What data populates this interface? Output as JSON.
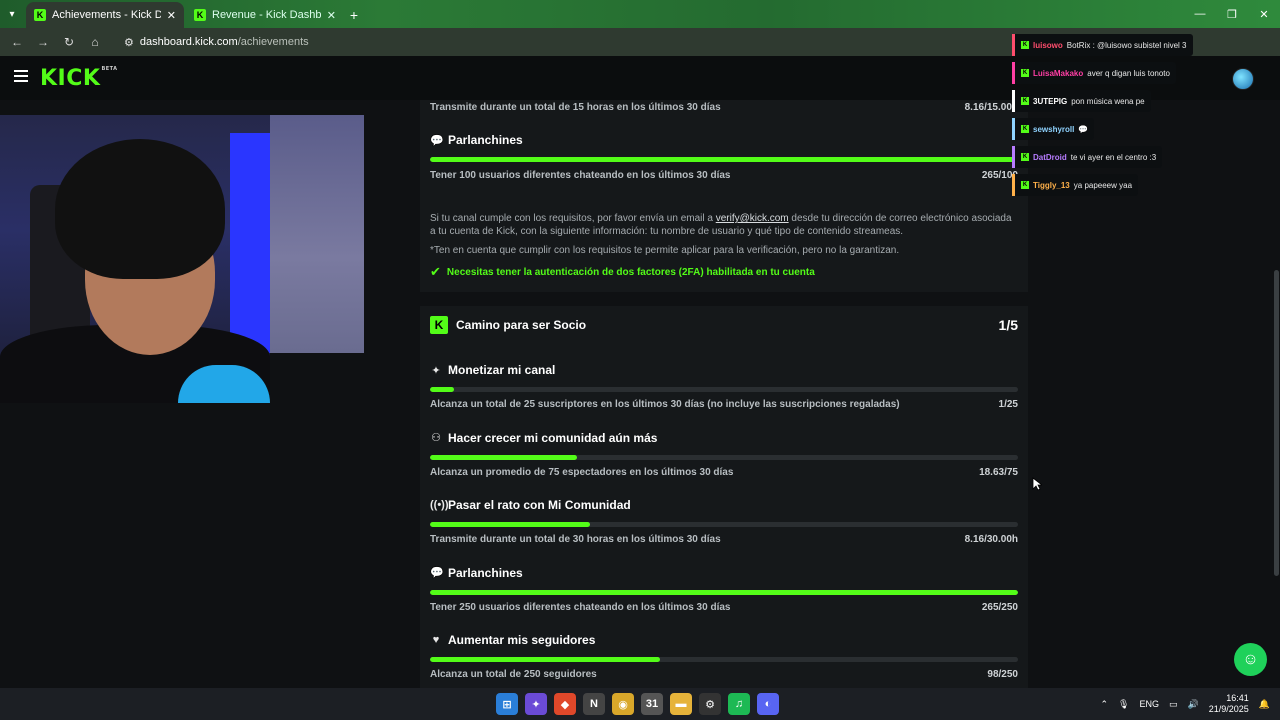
{
  "browser": {
    "tabs": [
      {
        "title": "Achievements - Kick Dashboard",
        "active": true
      },
      {
        "title": "Revenue - Kick Dashboard",
        "active": false
      }
    ],
    "url_host": "dashboard.kick.com",
    "url_path": "/achievements"
  },
  "header": {
    "logo": "KICK",
    "logo_badge": "BETA"
  },
  "verification": {
    "stream_hours_desc": "Transmite durante un total de 15 horas en los últimos 30 días",
    "stream_hours_value": "8.16/15.00h",
    "chatters_title": "Parlanchines",
    "chatters_desc": "Tener 100 usuarios diferentes chateando en los últimos 30 días",
    "chatters_value": "265/100",
    "chatters_progress": 1.0,
    "info_pre": "Si tu canal cumple con los requisitos, por favor envía un email a ",
    "info_email": "verify@kick.com",
    "info_post": " desde tu dirección de correo electrónico asociada a tu cuenta de Kick, con la siguiente información: tu nombre de usuario y qué tipo de contenido streameas.",
    "note": "*Ten en cuenta que cumplir con los requisitos te permite aplicar para la verificación, pero no la garantizan.",
    "twofa": "Necesitas tener la autenticación de dos factores (2FA) habilitada en tu cuenta"
  },
  "partner": {
    "title": "Camino para ser Socio",
    "count": "1/5",
    "items": [
      {
        "title": "Monetizar mi canal",
        "desc": "Alcanza un total de 25 suscriptores en los últimos 30 días (no incluye las suscripciones regaladas)",
        "value": "1/25",
        "progress": 0.04
      },
      {
        "title": "Hacer crecer mi comunidad aún más",
        "desc": "Alcanza un promedio de 75 espectadores en los últimos 30 días",
        "value": "18.63/75",
        "progress": 0.25
      },
      {
        "title": "Pasar el rato con Mi Comunidad",
        "desc": "Transmite durante un total de 30 horas en los últimos 30 días",
        "value": "8.16/30.00h",
        "progress": 0.272
      },
      {
        "title": "Parlanchines",
        "desc": "Tener 250 usuarios diferentes chateando en los últimos 30 días",
        "value": "265/250",
        "progress": 1.0
      },
      {
        "title": "Aumentar mis seguidores",
        "desc": "Alcanza un total de 250 seguidores",
        "value": "98/250",
        "progress": 0.392
      }
    ]
  },
  "chat": [
    {
      "user": "luisowo",
      "text": "BotRix : @luisowo subistel nivel 3",
      "color": "#ff4d6d"
    },
    {
      "user": "LuisaMakako",
      "text": "aver q digan luis tonoto",
      "color": "#ff3fa4"
    },
    {
      "user": "3UTEPIG",
      "text": "pon música wena pe",
      "color": "#ffffff"
    },
    {
      "user": "sewshyroll",
      "text": "💬",
      "color": "#8fd3ff"
    },
    {
      "user": "DatDroid",
      "text": "te vi ayer en el centro :3",
      "color": "#b77cff"
    },
    {
      "user": "Tiggly_13",
      "text": "ya papeeew yaa",
      "color": "#ffb14a"
    }
  ],
  "taskbar": {
    "lang": "ENG",
    "time": "16:41",
    "date": "21/9/2025"
  },
  "colors": {
    "accent": "#53fc18",
    "card": "#15181a",
    "bg": "#0f1113"
  }
}
